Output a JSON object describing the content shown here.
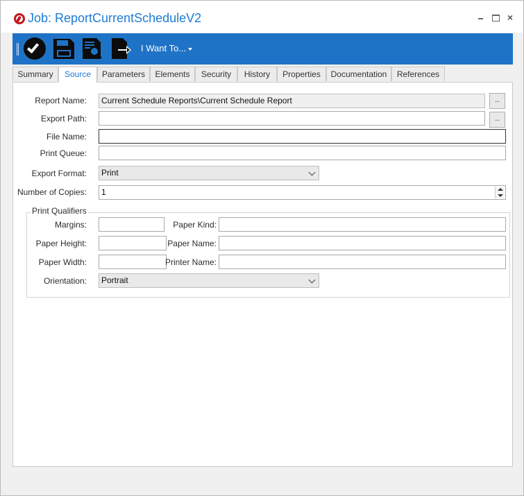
{
  "window": {
    "title": "Job: ReportCurrentScheduleV2",
    "controls": {
      "minimize": "minimize-icon",
      "maximize": "maximize-icon",
      "close": "×"
    }
  },
  "toolbar": {
    "buttons": [
      "checkmark-circle-icon",
      "save-disk-icon",
      "report-preview-icon",
      "export-document-icon"
    ],
    "menu_label": "I Want To..."
  },
  "tabs": [
    {
      "label": "Summary",
      "active": false
    },
    {
      "label": "Source",
      "active": true
    },
    {
      "label": "Parameters",
      "active": false
    },
    {
      "label": "Elements",
      "active": false
    },
    {
      "label": "Security",
      "active": false
    },
    {
      "label": "History",
      "active": false
    },
    {
      "label": "Properties",
      "active": false
    },
    {
      "label": "Documentation",
      "active": false
    },
    {
      "label": "References",
      "active": false
    }
  ],
  "form": {
    "report_name": {
      "label": "Report Name:",
      "value": "Current Schedule Reports\\Current Schedule Report",
      "browse": ".."
    },
    "export_path": {
      "label": "Export Path:",
      "value": "",
      "browse": ".."
    },
    "file_name": {
      "label": "File Name:",
      "value": ""
    },
    "print_queue": {
      "label": "Print Queue:",
      "value": ""
    },
    "export_format": {
      "label": "Export Format:",
      "value": "Print"
    },
    "number_of_copies": {
      "label": "Number of Copies:",
      "value": "1"
    }
  },
  "print_qualifiers": {
    "title": "Print Qualifiers",
    "margins": {
      "label": "Margins:",
      "value": ""
    },
    "paper_kind": {
      "label": "Paper Kind:",
      "value": ""
    },
    "paper_height": {
      "label": "Paper Height:",
      "value": ""
    },
    "paper_name": {
      "label": "Paper Name:",
      "value": ""
    },
    "paper_width": {
      "label": "Paper Width:",
      "value": ""
    },
    "printer_name": {
      "label": "Printer Name:",
      "value": ""
    },
    "orientation": {
      "label": "Orientation:",
      "value": "Portrait"
    }
  },
  "colors": {
    "accent": "#1f73c6",
    "title": "#1e7bd6",
    "logo": "#c3171e"
  }
}
